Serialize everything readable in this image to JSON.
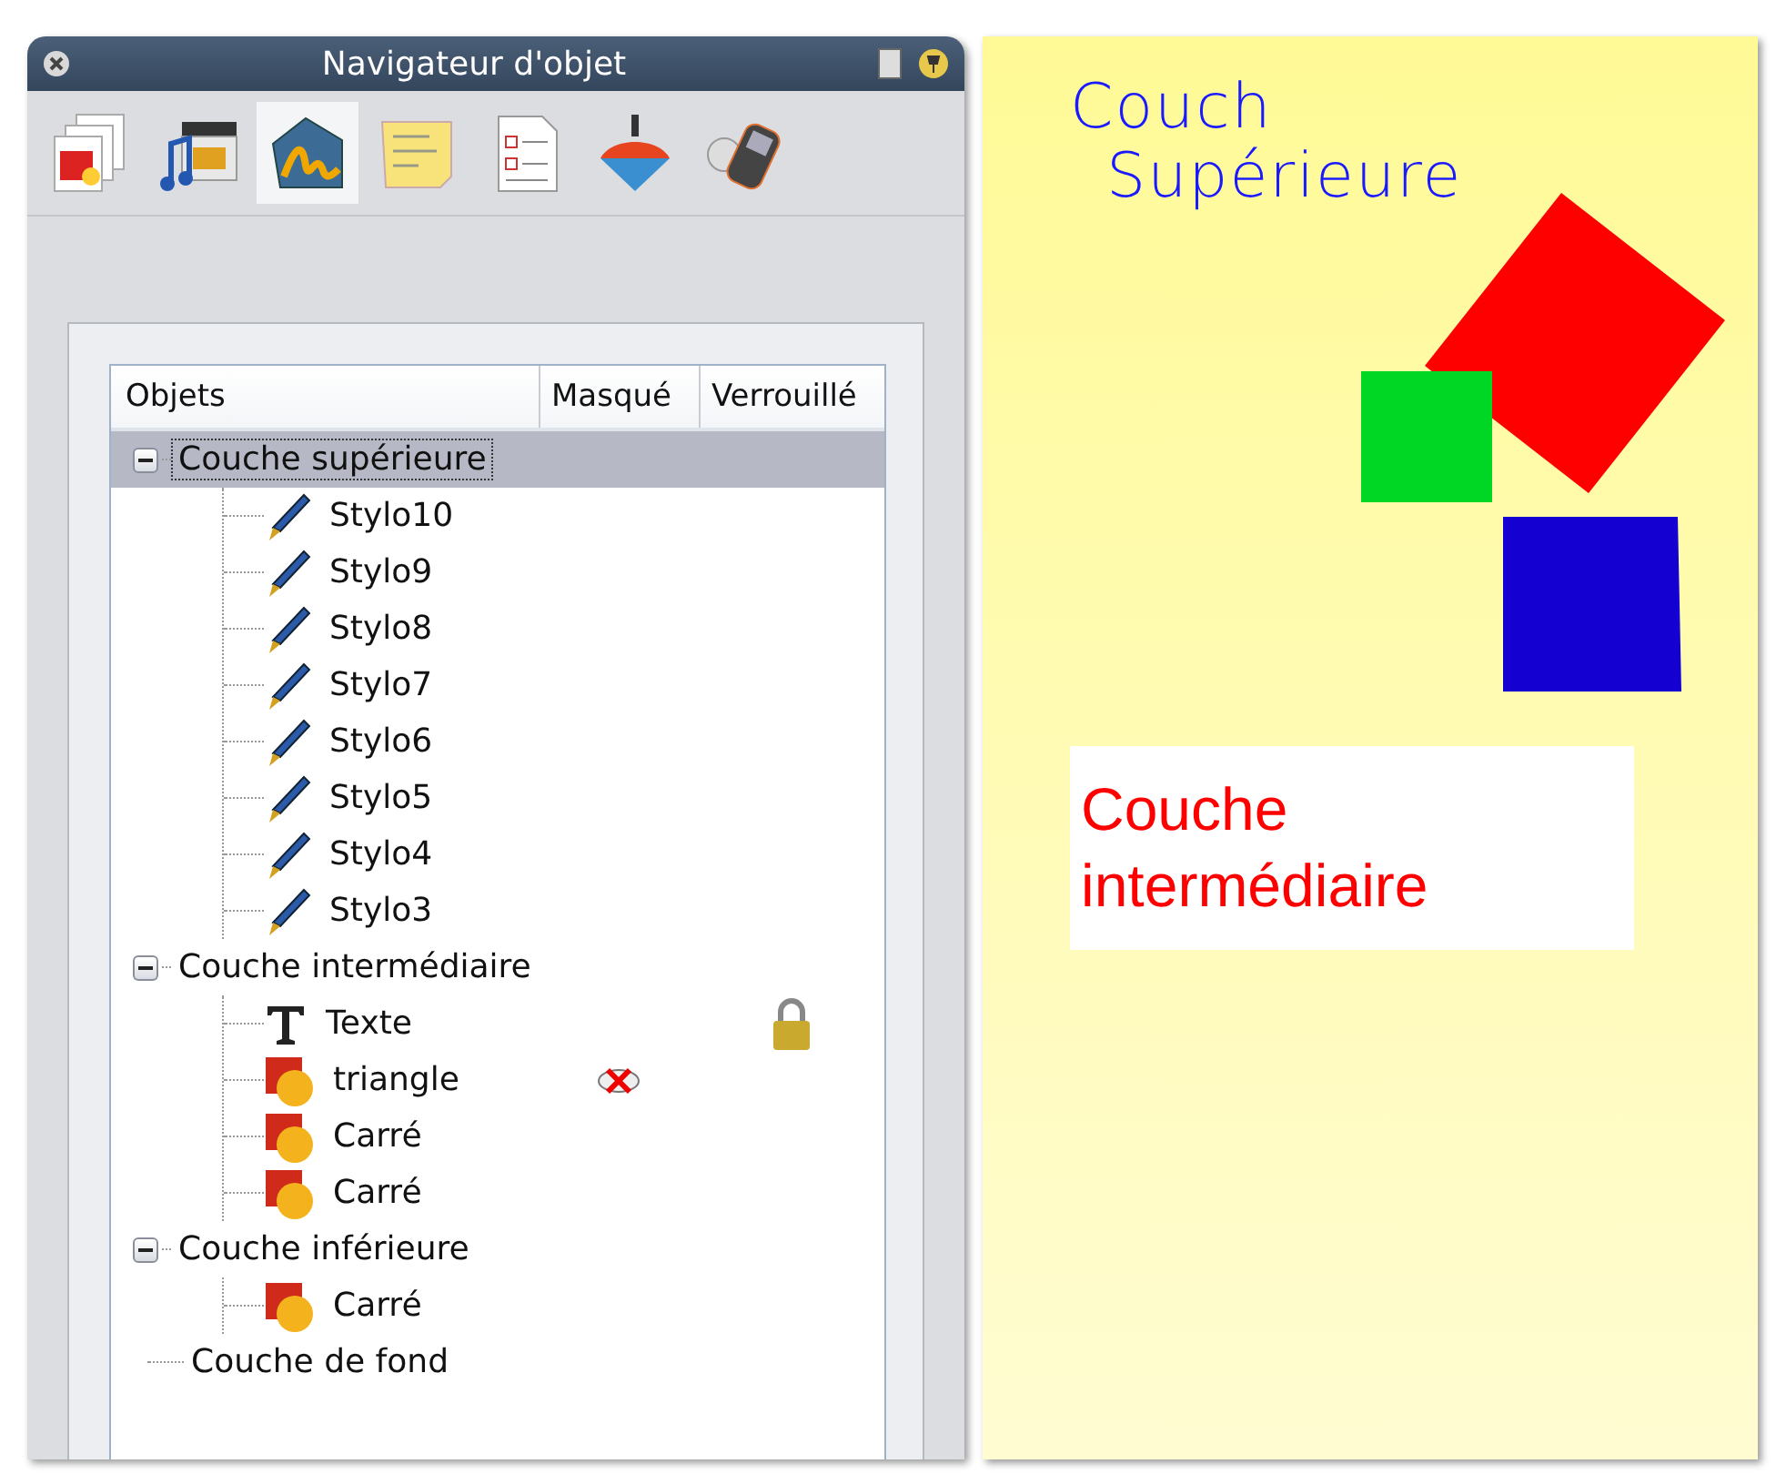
{
  "window": {
    "title": "Navigateur d'objet"
  },
  "toolbar": [
    {
      "kind": "pages",
      "selected": false
    },
    {
      "kind": "media",
      "selected": false
    },
    {
      "kind": "drawing",
      "selected": true
    },
    {
      "kind": "note",
      "selected": false
    },
    {
      "kind": "form",
      "selected": false
    },
    {
      "kind": "top",
      "selected": false
    },
    {
      "kind": "device",
      "selected": false
    }
  ],
  "tree": {
    "columns": [
      "Objets",
      "Masqué",
      "Verrouillé"
    ],
    "layers": [
      {
        "label": "Couche supérieure",
        "selected": true,
        "expanded": true,
        "children": [
          {
            "label": "Stylo10",
            "kind": "pen",
            "hidden": false,
            "locked": false
          },
          {
            "label": "Stylo9",
            "kind": "pen",
            "hidden": false,
            "locked": false
          },
          {
            "label": "Stylo8",
            "kind": "pen",
            "hidden": false,
            "locked": false
          },
          {
            "label": "Stylo7",
            "kind": "pen",
            "hidden": false,
            "locked": false
          },
          {
            "label": "Stylo6",
            "kind": "pen",
            "hidden": false,
            "locked": false
          },
          {
            "label": "Stylo5",
            "kind": "pen",
            "hidden": false,
            "locked": false
          },
          {
            "label": "Stylo4",
            "kind": "pen",
            "hidden": false,
            "locked": false
          },
          {
            "label": "Stylo3",
            "kind": "pen",
            "hidden": false,
            "locked": false
          }
        ]
      },
      {
        "label": "Couche intermédiaire",
        "selected": false,
        "expanded": true,
        "children": [
          {
            "label": "Texte",
            "kind": "text",
            "hidden": false,
            "locked": true
          },
          {
            "label": "triangle",
            "kind": "shape",
            "hidden": true,
            "locked": false
          },
          {
            "label": "Carré",
            "kind": "shape",
            "hidden": false,
            "locked": false
          },
          {
            "label": "Carré",
            "kind": "shape",
            "hidden": false,
            "locked": false
          }
        ]
      },
      {
        "label": "Couche inférieure",
        "selected": false,
        "expanded": true,
        "children": [
          {
            "label": "Carré",
            "kind": "shape",
            "hidden": false,
            "locked": false
          }
        ]
      },
      {
        "label": "Couche de fond",
        "selected": false
      }
    ]
  },
  "canvas": {
    "handwriting": [
      "Couch",
      "Supérieure"
    ],
    "text_box": "Couche intermédiaire"
  }
}
